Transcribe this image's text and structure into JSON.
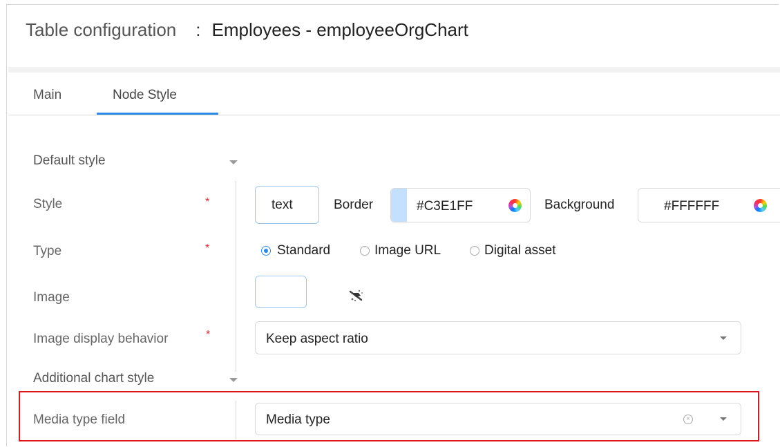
{
  "title": {
    "label": "Table configuration",
    "separator": ":",
    "value": "Employees - employeeOrgChart"
  },
  "tabs": [
    {
      "label": "Main"
    },
    {
      "label": "Node Style",
      "active": true
    }
  ],
  "sections": {
    "default_style": "Default style",
    "additional_chart_style": "Additional chart style"
  },
  "fields": {
    "style": {
      "label": "Style",
      "required": "*",
      "text_value": "text",
      "border_label": "Border",
      "border_color": "#C3E1FF",
      "background_label": "Background",
      "background_color": "#FFFFFF"
    },
    "type": {
      "label": "Type",
      "required": "*",
      "options": [
        "Standard",
        "Image URL",
        "Digital asset"
      ],
      "selected": "Standard"
    },
    "image": {
      "label": "Image",
      "icon": "image-picker-icon"
    },
    "image_display": {
      "label": "Image display behavior",
      "required": "*",
      "value": "Keep aspect ratio"
    },
    "media_type": {
      "label": "Media type field",
      "value": "Media type"
    }
  },
  "colors": {
    "accent": "#2d89e5",
    "required": "#d9262c",
    "highlight": "#e0161d",
    "border_swatch": "#C3E1FF"
  }
}
